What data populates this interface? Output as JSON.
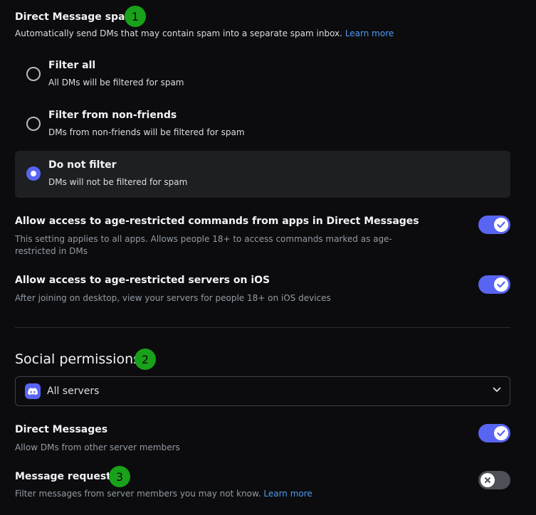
{
  "dm_spam": {
    "title": "Direct Message spam",
    "badge": "1",
    "description": "Automatically send DMs that may contain spam into a separate spam inbox.",
    "learn_more": "Learn more",
    "options": [
      {
        "label": "Filter all",
        "desc": "All DMs will be filtered for spam",
        "selected": false
      },
      {
        "label": "Filter from non-friends",
        "desc": "DMs from non-friends will be filtered for spam",
        "selected": false
      },
      {
        "label": "Do not filter",
        "desc": "DMs will not be filtered for spam",
        "selected": true
      }
    ]
  },
  "age_commands": {
    "title": "Allow access to age-restricted commands from apps in Direct Messages",
    "desc_line1": "This setting applies to all apps. Allows people 18+ to access commands marked as age-",
    "desc_line2": "restricted in DMs",
    "enabled": true
  },
  "age_servers": {
    "title": "Allow access to age-restricted servers on iOS",
    "desc": "After joining on desktop, view your servers for people 18+ on iOS devices",
    "enabled": true
  },
  "social": {
    "title": "Social permissions",
    "badge": "2",
    "server_select": {
      "value": "All servers",
      "icon": "discord-icon"
    }
  },
  "direct_messages": {
    "title": "Direct Messages",
    "desc": "Allow DMs from other server members",
    "enabled": true
  },
  "message_requests": {
    "title": "Message requests",
    "badge": "3",
    "desc": "Filter messages from server members you may not know.",
    "learn_more": "Learn more",
    "enabled": false
  },
  "colors": {
    "accent": "#5865f2",
    "badge": "#1aa11a",
    "link": "#4e9bf5",
    "background": "#0c0c0e"
  }
}
